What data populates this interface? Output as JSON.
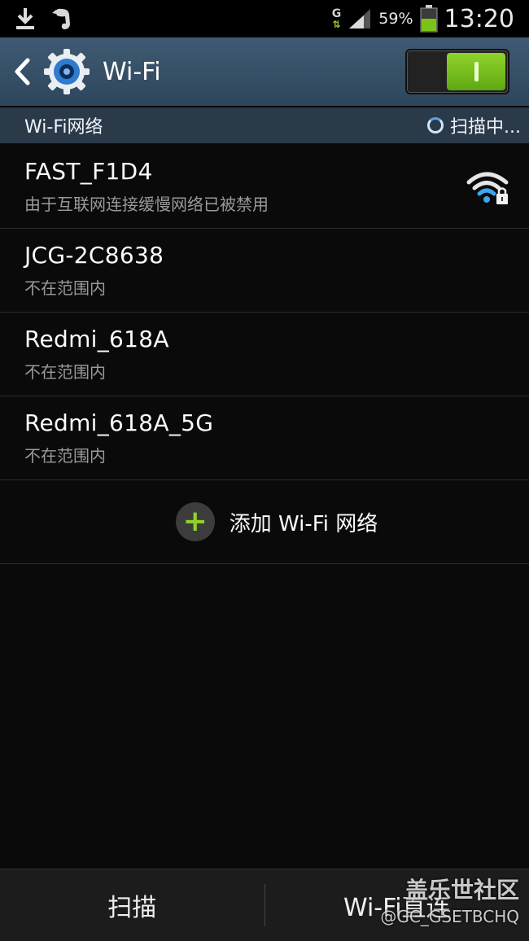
{
  "status_bar": {
    "icons": [
      "download-icon",
      "evernote-icon"
    ],
    "network_type": "G",
    "battery_percent": "59%",
    "time": "13:20"
  },
  "action_bar": {
    "title": "Wi-Fi",
    "toggle_on": true
  },
  "section": {
    "title": "Wi-Fi网络",
    "scan_status": "扫描中..."
  },
  "networks": [
    {
      "ssid": "FAST_F1D4",
      "status": "由于互联网连接缓慢网络已被禁用",
      "icon": "wifi-locked-icon"
    },
    {
      "ssid": "JCG-2C8638",
      "status": "不在范围内"
    },
    {
      "ssid": "Redmi_618A",
      "status": "不在范围内"
    },
    {
      "ssid": "Redmi_618A_5G",
      "status": "不在范围内"
    }
  ],
  "add_network": {
    "label": "添加 Wi-Fi 网络"
  },
  "bottom_bar": {
    "scan_label": "扫描",
    "direct_label": "Wi-Fi直连"
  },
  "watermark": {
    "line1": "盖乐世社区",
    "line2": "@GC_GSETBCHQ"
  },
  "colors": {
    "accent_green": "#8fd32a",
    "action_bar": "#3f5a72",
    "section_bg": "#2b3a49"
  }
}
